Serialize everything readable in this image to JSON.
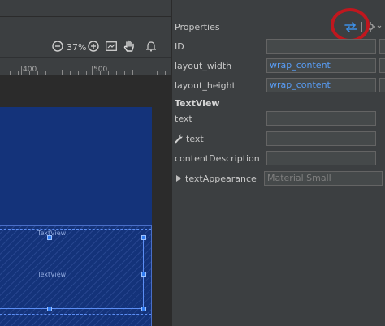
{
  "toolbar": {
    "zoom_out_icon": "zoom-out-icon",
    "zoom_level": "37%",
    "zoom_in_icon": "zoom-in-icon",
    "fit_icon": "fit-screen-icon",
    "pan_icon": "pan-hand-icon",
    "notification_icon": "bell-icon"
  },
  "ruler": {
    "labels": [
      "400",
      "500"
    ]
  },
  "canvas": {
    "textview_label_top": "TextView",
    "textview_label_middle": "TextView",
    "device_color": "#14337a",
    "selection_color": "#2f7bf0"
  },
  "properties": {
    "title": "Properties",
    "swap_icon": "swap-view-icon",
    "settings_icon": "gear-icon",
    "highlight_color": "#c0171e",
    "rows": [
      {
        "label": "ID",
        "value": ""
      },
      {
        "label": "layout_width",
        "value": "wrap_content"
      },
      {
        "label": "layout_height",
        "value": "wrap_content"
      }
    ],
    "section": "TextView",
    "text_rows": [
      {
        "label": "text",
        "value": ""
      },
      {
        "label": "text",
        "value": "",
        "icon": "wrench-icon"
      },
      {
        "label": "contentDescription",
        "value": ""
      }
    ],
    "text_appearance": {
      "label": "textAppearance",
      "value": "Material.Small",
      "icon": "expand-triangle-icon"
    }
  }
}
